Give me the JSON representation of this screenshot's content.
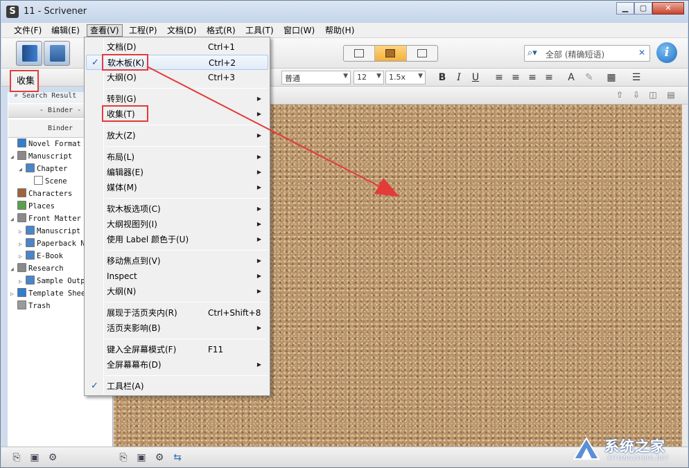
{
  "window": {
    "title": "11 - Scrivener",
    "app_icon_glyph": "S",
    "controls": {
      "minimize": "▁",
      "maximize": "▢",
      "close": "✕"
    }
  },
  "menubar": {
    "items": [
      "文件(F)",
      "编辑(E)",
      "查看(V)",
      "工程(P)",
      "文档(D)",
      "格式(R)",
      "工具(T)",
      "窗口(W)",
      "帮助(H)"
    ],
    "active_index": 2
  },
  "toolbar": {
    "search_placeholder": "全部 (精确短语)",
    "view_mode_active": "corkboard",
    "info_glyph": "i"
  },
  "format_bar": {
    "collection_label": "收集",
    "style_value": "普通",
    "font_size_value": "12",
    "line_spacing_value": "1.5x",
    "bold": "B",
    "italic": "I",
    "underline": "U"
  },
  "binder": {
    "search_results_label": "Search Result",
    "binder_tab_label": "- Binder -",
    "binder_header": "Binder",
    "tree": [
      {
        "label": "Novel Format",
        "depth": 0,
        "twisty": "",
        "icon": "info-icon",
        "color": "#2f7fd0"
      },
      {
        "label": "Manuscript",
        "depth": 0,
        "twisty": "◢",
        "icon": "manuscript-icon",
        "color": "#8a8a8a"
      },
      {
        "label": "Chapter",
        "depth": 1,
        "twisty": "◢",
        "icon": "folder-icon",
        "color": "#4a86c8"
      },
      {
        "label": "Scene",
        "depth": 2,
        "twisty": "",
        "icon": "document-icon",
        "color": "#ffffff"
      },
      {
        "label": "Characters",
        "depth": 0,
        "twisty": "",
        "icon": "characters-icon",
        "color": "#a0643a"
      },
      {
        "label": "Places",
        "depth": 0,
        "twisty": "",
        "icon": "places-icon",
        "color": "#5aa04a"
      },
      {
        "label": "Front Matter",
        "depth": 0,
        "twisty": "◢",
        "icon": "front-matter-icon",
        "color": "#8a8a8a"
      },
      {
        "label": "Manuscript F",
        "depth": 1,
        "twisty": "▷",
        "icon": "folder-icon",
        "color": "#4a86c8"
      },
      {
        "label": "Paperback N",
        "depth": 1,
        "twisty": "▷",
        "icon": "folder-icon",
        "color": "#4a86c8"
      },
      {
        "label": "E-Book",
        "depth": 1,
        "twisty": "▷",
        "icon": "folder-icon",
        "color": "#4a86c8"
      },
      {
        "label": "Research",
        "depth": 0,
        "twisty": "◢",
        "icon": "research-icon",
        "color": "#8a8a8a"
      },
      {
        "label": "Sample Outpu",
        "depth": 1,
        "twisty": "▷",
        "icon": "folder-icon",
        "color": "#4a86c8"
      },
      {
        "label": "Template Shee",
        "depth": 0,
        "twisty": "▷",
        "icon": "template-icon",
        "color": "#2f7fd0"
      },
      {
        "label": "Trash",
        "depth": 0,
        "twisty": "",
        "icon": "trash-icon",
        "color": "#9a9a9a"
      }
    ]
  },
  "view_menu": {
    "items": [
      {
        "label": "文档(D)",
        "shortcut": "Ctrl+1",
        "submenu": false,
        "checked": false,
        "name": "menu-item-document"
      },
      {
        "label": "软木板(K)",
        "shortcut": "Ctrl+2",
        "submenu": false,
        "checked": true,
        "highlighted": true,
        "name": "menu-item-corkboard"
      },
      {
        "label": "大纲(O)",
        "shortcut": "Ctrl+3",
        "submenu": false,
        "checked": false,
        "name": "menu-item-outline"
      },
      {
        "sep": true
      },
      {
        "label": "转到(G)",
        "shortcut": "",
        "submenu": true,
        "checked": false,
        "name": "menu-item-goto"
      },
      {
        "label": "收集(T)",
        "shortcut": "",
        "submenu": true,
        "checked": false,
        "name": "menu-item-collections"
      },
      {
        "sep": true
      },
      {
        "label": "放大(Z)",
        "shortcut": "",
        "submenu": true,
        "checked": false,
        "name": "menu-item-zoom"
      },
      {
        "sep": true
      },
      {
        "label": "布局(L)",
        "shortcut": "",
        "submenu": true,
        "checked": false,
        "name": "menu-item-layout"
      },
      {
        "label": "编辑器(E)",
        "shortcut": "",
        "submenu": true,
        "checked": false,
        "name": "menu-item-editor"
      },
      {
        "label": "媒体(M)",
        "shortcut": "",
        "submenu": true,
        "checked": false,
        "name": "menu-item-media"
      },
      {
        "sep": true
      },
      {
        "label": "软木板选项(C)",
        "shortcut": "",
        "submenu": true,
        "checked": false,
        "name": "menu-item-corkboard-options"
      },
      {
        "label": "大纲视图列(I)",
        "shortcut": "",
        "submenu": true,
        "checked": false,
        "name": "menu-item-outline-columns"
      },
      {
        "label": "使用 Label 颜色于(U)",
        "shortcut": "",
        "submenu": true,
        "checked": false,
        "name": "menu-item-label-colors"
      },
      {
        "sep": true
      },
      {
        "label": "移动焦点到(V)",
        "shortcut": "",
        "submenu": true,
        "checked": false,
        "name": "menu-item-move-focus"
      },
      {
        "label": "Inspect",
        "shortcut": "",
        "submenu": true,
        "checked": false,
        "name": "menu-item-inspect"
      },
      {
        "label": "大纲(N)",
        "shortcut": "",
        "submenu": true,
        "checked": false,
        "name": "menu-item-outline-submenu"
      },
      {
        "sep": true
      },
      {
        "label": "展现于活页夹内(R)",
        "shortcut": "Ctrl+Shift+8",
        "submenu": false,
        "checked": false,
        "name": "menu-item-reveal-in-binder"
      },
      {
        "label": "活页夹影响(B)",
        "shortcut": "",
        "submenu": true,
        "checked": false,
        "name": "menu-item-binder-affects"
      },
      {
        "sep": true
      },
      {
        "label": "键入全屏幕模式(F)",
        "shortcut": "F11",
        "submenu": false,
        "checked": false,
        "name": "menu-item-fullscreen"
      },
      {
        "label": "全屏幕幕布(D)",
        "shortcut": "",
        "submenu": true,
        "checked": false,
        "name": "menu-item-fullscreen-backdrop"
      },
      {
        "sep": true
      },
      {
        "label": "工具栏(A)",
        "shortcut": "",
        "submenu": false,
        "checked": true,
        "name": "menu-item-toolbar"
      }
    ]
  },
  "watermark": {
    "text": "系统之家",
    "sub": "XITONGZHIJIA.NET"
  },
  "colors": {
    "highlight_box": "#e33a3a",
    "corkboard": "#b9946b",
    "menu_bg": "#f0f0f0"
  }
}
